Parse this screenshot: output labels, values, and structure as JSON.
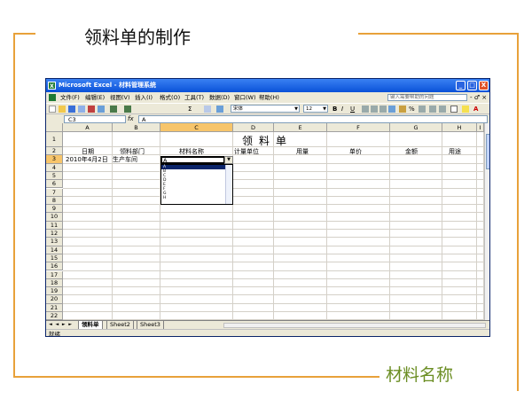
{
  "slide": {
    "title": "领料单的制作",
    "caption": "材料名称",
    "accent_color": "#e8a13a",
    "caption_color": "#6b8e23"
  },
  "window": {
    "title": "Microsoft Excel - 材料管理系统",
    "app_icon": "excel-icon",
    "controls": [
      "_",
      "□",
      "X"
    ]
  },
  "menu": {
    "items": [
      "文件(F)",
      "编辑(E)",
      "视图(V)",
      "插入(I)",
      "格式(O)",
      "工具(T)",
      "数据(D)",
      "窗口(W)",
      "帮助(H)"
    ],
    "help_placeholder": "键入需要帮助的问题",
    "window_controls": "- ♂ ×"
  },
  "toolbar": {
    "sigma": "Σ",
    "font": "宋体",
    "size": "12",
    "bold": "B",
    "italic": "I",
    "underline": "U",
    "percent": "%",
    "font_color_label": "A"
  },
  "formula_bar": {
    "name_box": "C3",
    "fx": "fx",
    "value": "A"
  },
  "sheet": {
    "columns": [
      "A",
      "B",
      "C",
      "D",
      "E",
      "F",
      "G",
      "H",
      "I"
    ],
    "rows": [
      "1",
      "2",
      "3",
      "4",
      "5",
      "6",
      "7",
      "8",
      "9",
      "10",
      "11",
      "12",
      "13",
      "14",
      "15",
      "16",
      "17",
      "18",
      "19",
      "20",
      "21",
      "22"
    ],
    "title": "领料单",
    "headers": [
      "日期",
      "领料部门",
      "材料名称",
      "计量单位",
      "用量",
      "单价",
      "金额",
      "用途"
    ],
    "row3": {
      "date": "2010年4月2日",
      "department": "生产车间",
      "material": "A"
    },
    "dropdown_options": [
      "A",
      "B",
      "C",
      "D",
      "E",
      "F",
      "G",
      "H"
    ],
    "dropdown_selected": "A",
    "selected_cell": "C3"
  },
  "tabs": {
    "nav": "◄ ◄ ► ►",
    "items": [
      "领料单",
      "Sheet2",
      "Sheet3"
    ],
    "active": "领料单"
  },
  "status": {
    "text": "就绪"
  }
}
